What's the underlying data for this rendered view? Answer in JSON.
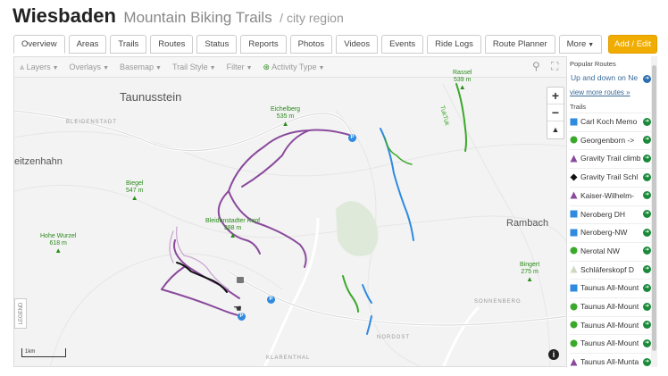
{
  "header": {
    "city": "Wiesbaden",
    "subtitle": "Mountain Biking Trails",
    "region": "/ city region"
  },
  "tabs": [
    {
      "label": "Overview",
      "active": true
    },
    {
      "label": "Areas"
    },
    {
      "label": "Trails"
    },
    {
      "label": "Routes"
    },
    {
      "label": "Status"
    },
    {
      "label": "Reports"
    },
    {
      "label": "Photos"
    },
    {
      "label": "Videos"
    },
    {
      "label": "Events"
    },
    {
      "label": "Ride Logs"
    },
    {
      "label": "Route Planner"
    },
    {
      "label": "More",
      "dropdown": true
    }
  ],
  "add_button": "Add / Edit",
  "toolbar": {
    "layers": "Layers",
    "overlays": "Overlays",
    "basemap": "Basemap",
    "trail_style": "Trail Style",
    "filter": "Filter",
    "activity_type": "Activity Type"
  },
  "map": {
    "places": {
      "taunusstein": "Taunusstein",
      "bleidenstadt": "BLEIDENSTADT",
      "seitzenhahn": "eitzenhahn",
      "rambach": "Rambach",
      "sonnenberg": "SONNENBERG",
      "nordost": "NORDOST",
      "klarenthal": "KLARENTHAL"
    },
    "peaks": {
      "rassel": {
        "name": "Rassel",
        "elev": "539 m"
      },
      "eichelberg": {
        "name": "Eichelberg",
        "elev": "535 m"
      },
      "biegel": {
        "name": "Biegel",
        "elev": "547 m"
      },
      "bleidenstadter_kopf": {
        "name": "Bleidenstadter Kopf",
        "elev": "388 m"
      },
      "hohe_wurzel": {
        "name": "Hohe Wurzel",
        "elev": "618 m"
      },
      "bingert": {
        "name": "Bingert",
        "elev": "275 m"
      }
    },
    "trail_label": "TukTuk",
    "legend": "LEGEND",
    "scale": "1km",
    "zoom_in": "+",
    "zoom_out": "−",
    "compass": "▲",
    "info": "i",
    "parking": "P",
    "colors": {
      "purple": "#8a4a9c",
      "blue": "#2f8be0",
      "green": "#3aa82a",
      "black": "#111111",
      "road": "#ffffff"
    }
  },
  "sidebar": {
    "popular_routes_title": "Popular Routes",
    "popular_route": "Up and down on Ne",
    "more_routes": "view more routes »",
    "trails_title": "Trails",
    "trails": [
      {
        "name": "Carl Koch Memo",
        "icon": "blue-square"
      },
      {
        "name": "Georgenborn ->",
        "icon": "green-circle"
      },
      {
        "name": "Gravity Trail climb",
        "icon": "purple-triangle"
      },
      {
        "name": "Gravity Trail Schl",
        "icon": "black-diamond"
      },
      {
        "name": "Kaiser-Wilhelm-",
        "icon": "purple-triangle"
      },
      {
        "name": "Neroberg DH",
        "icon": "blue-square"
      },
      {
        "name": "Neroberg-NW",
        "icon": "blue-square"
      },
      {
        "name": "Nerotal NW",
        "icon": "green-circle"
      },
      {
        "name": "Schläferskopf D",
        "icon": "gray-triangle"
      },
      {
        "name": "Taunus All-Mount",
        "icon": "blue-square"
      },
      {
        "name": "Taunus All-Mount",
        "icon": "green-circle"
      },
      {
        "name": "Taunus All-Mount",
        "icon": "green-circle"
      },
      {
        "name": "Taunus All-Mount",
        "icon": "green-circle"
      },
      {
        "name": "Taunus All-Munta",
        "icon": "purple-triangle"
      }
    ]
  }
}
